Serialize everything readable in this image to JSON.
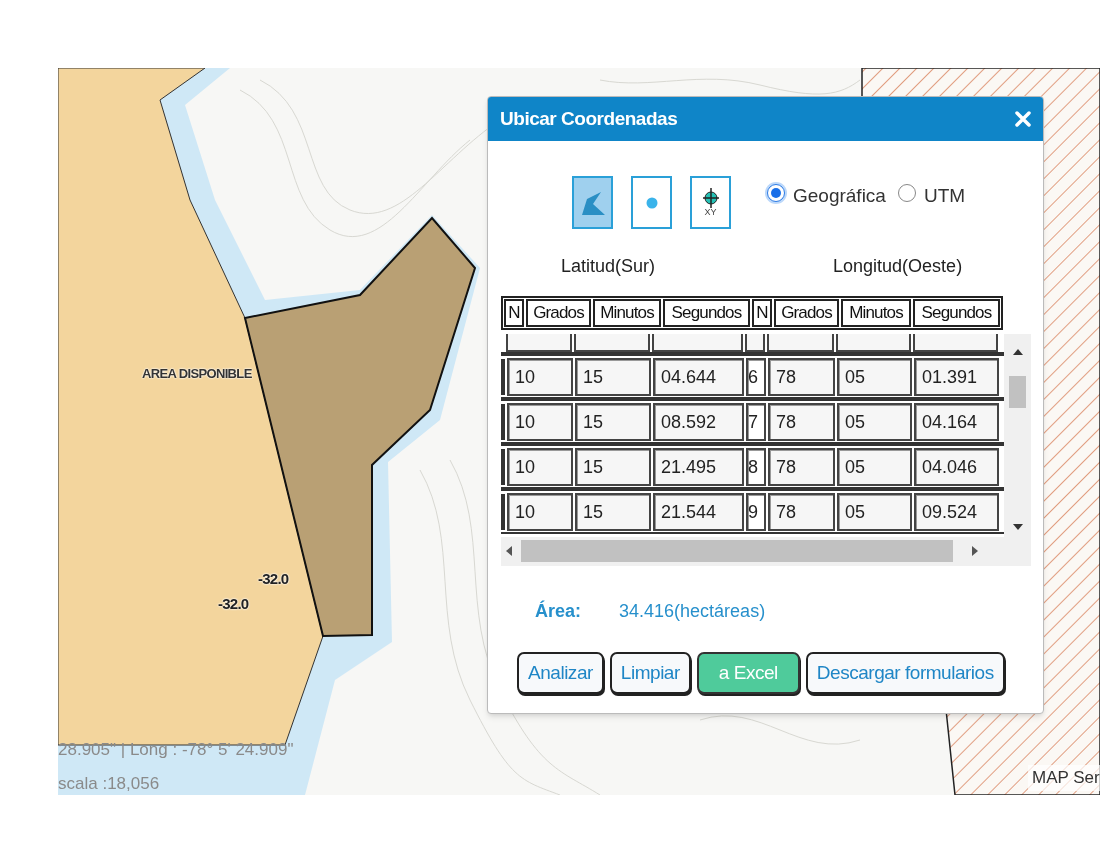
{
  "map": {
    "labels": [
      {
        "kind": "area",
        "text": "AREA DISPONIBLE"
      },
      {
        "kind": "depth",
        "text": "-32.0"
      },
      {
        "kind": "depth",
        "text": "-32.0"
      }
    ],
    "coordinates": "28.905\" | Long : -78° 5' 24.909\"",
    "scale": "scala :18,056",
    "attribution": "MAP Ser"
  },
  "dialog": {
    "title": "Ubicar Coordenadas",
    "tools": [
      {
        "kind": "polygon",
        "selected": true
      },
      {
        "kind": "point",
        "selected": false
      },
      {
        "kind": "xy",
        "selected": false,
        "label": "XY"
      }
    ],
    "radios": [
      {
        "label": "Geográfica",
        "selected": true
      },
      {
        "label": "UTM",
        "selected": false
      }
    ],
    "group_headers": [
      "Latitud(Sur)",
      "Longitud(Oeste)"
    ],
    "columns": [
      "N",
      "Grados",
      "Minutos",
      "Segundos",
      "N",
      "Grados",
      "Minutos",
      "Segundos"
    ],
    "rows": [
      [
        "",
        "10",
        "15",
        "04.644",
        "6",
        "78",
        "05",
        "01.391"
      ],
      [
        "",
        "10",
        "15",
        "08.592",
        "7",
        "78",
        "05",
        "04.164"
      ],
      [
        "",
        "10",
        "15",
        "21.495",
        "8",
        "78",
        "05",
        "04.046"
      ],
      [
        "",
        "10",
        "15",
        "21.544",
        "9",
        "78",
        "05",
        "09.524"
      ]
    ],
    "area_label": "Área:",
    "area_value": "34.416(hectáreas)",
    "buttons": [
      {
        "label": "Analizar",
        "kind": "default"
      },
      {
        "label": "Limpiar",
        "kind": "default"
      },
      {
        "label": "a Excel",
        "kind": "primary"
      },
      {
        "label": "Descargar formularios",
        "kind": "default"
      }
    ]
  }
}
